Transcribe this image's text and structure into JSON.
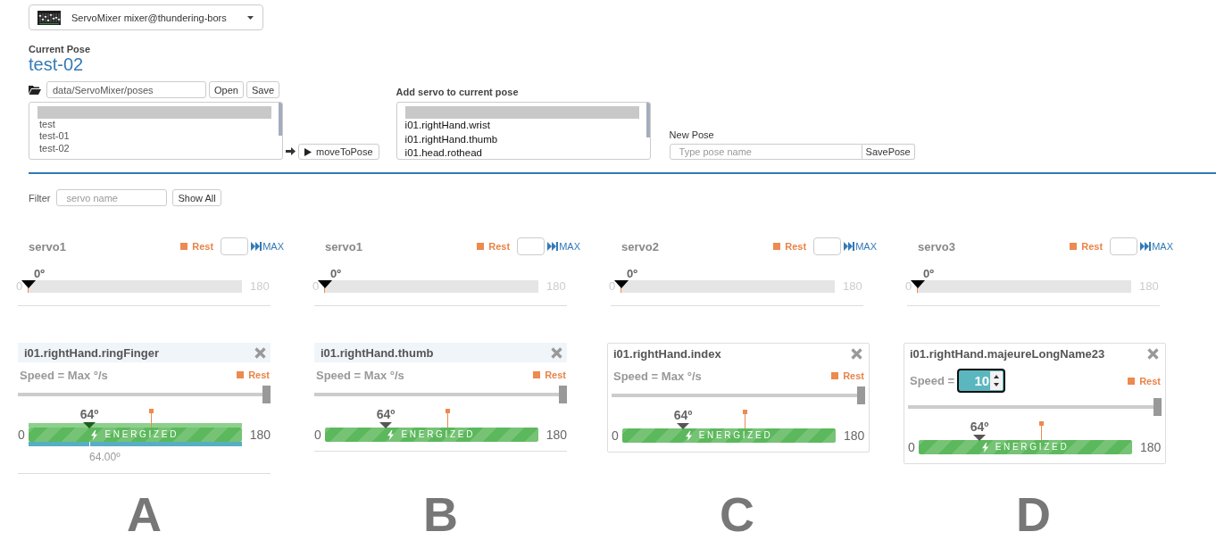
{
  "header": {
    "app": "ServoMixer",
    "service": "mixer@thundering-bors"
  },
  "current_pose": {
    "label": "Current Pose",
    "name": "test-02"
  },
  "pose_files": {
    "path": "data/ServoMixer/poses",
    "open_button": "Open",
    "save_button": "Save",
    "items": [
      {
        "selected": true
      },
      {
        "label": "test",
        "selected": false
      },
      {
        "label": "test-01",
        "selected": false
      },
      {
        "label": "test-02",
        "selected": false
      }
    ]
  },
  "move_button": "moveToPose",
  "add_servo": {
    "title": "Add servo to current pose",
    "items": [
      {
        "selected": true
      },
      {
        "label": "i01.rightHand.wrist",
        "selected": false
      },
      {
        "label": "i01.rightHand.thumb",
        "selected": false
      },
      {
        "label": "i01.head.rothead",
        "selected": false
      }
    ]
  },
  "new_pose": {
    "label": "New Pose",
    "placeholder": "Type pose name",
    "button": "SavePose"
  },
  "filter": {
    "label": "Filter",
    "placeholder": "servo name",
    "button": "Show All"
  },
  "servos": [
    {
      "name": "servo1",
      "rest": "Rest",
      "max": "MAX",
      "angle": "0º",
      "min": "0",
      "max_value": "180",
      "position": {
        "level": 0
      },
      "rest_marker": {
        "level": 0
      }
    },
    {
      "name": "servo1",
      "rest": "Rest",
      "max": "MAX",
      "angle": "0º",
      "min": "0",
      "max_value": "180",
      "position": {
        "level": 0
      },
      "rest_marker": {
        "level": 0
      }
    },
    {
      "name": "servo2",
      "rest": "Rest",
      "max": "MAX",
      "angle": "0º",
      "min": "0",
      "max_value": "180",
      "position": {
        "level": 0
      },
      "rest_marker": {
        "level": 0
      }
    },
    {
      "name": "servo3",
      "rest": "Rest",
      "max": "MAX",
      "angle": "0º",
      "min": "0",
      "max_value": "180",
      "position": {
        "level": 0
      },
      "rest_marker": {
        "level": 0
      }
    }
  ],
  "cards": [
    {
      "kind": "flat",
      "title": "i01.rightHand.ringFinger",
      "speed": {
        "kind": "text",
        "label": "Speed = Max °/s"
      },
      "rest": "Rest",
      "speed_slider": {
        "level": 1
      },
      "angle": "64º",
      "position": {
        "level": 0.285
      },
      "rest_marker": {
        "level": 0.573
      },
      "min": "0",
      "max": "180",
      "energized": true,
      "status": "ENERGIZED",
      "hover": true,
      "feedback": {
        "level": 0.285,
        "reading": "64.00º"
      },
      "caption": "A"
    },
    {
      "kind": "flat",
      "title": "i01.rightHand.thumb",
      "speed": {
        "kind": "text",
        "label": "Speed = Max °/s"
      },
      "rest": "Rest",
      "speed_slider": {
        "level": 1
      },
      "angle": "64º",
      "position": {
        "level": 0.285
      },
      "rest_marker": {
        "level": 0.573
      },
      "min": "0",
      "max": "180",
      "energized": true,
      "status": "ENERGIZED",
      "hover": false,
      "caption": "B"
    },
    {
      "kind": "boxed",
      "title": "i01.rightHand.index",
      "speed": {
        "kind": "text",
        "label": "Speed = Max °/s"
      },
      "rest": "Rest",
      "speed_slider": {
        "level": 1
      },
      "angle": "64º",
      "position": {
        "level": 0.285
      },
      "rest_marker": {
        "level": 0.573
      },
      "min": "0",
      "max": "180",
      "energized": true,
      "status": "ENERGIZED",
      "hover": false,
      "caption": "C"
    },
    {
      "kind": "boxed",
      "title": "i01.rightHand.majeureLongName23",
      "speed": {
        "kind": "spinner",
        "label": "Speed =",
        "value": "10",
        "focused": true
      },
      "rest": "Rest",
      "speed_slider": {
        "level": 1
      },
      "angle": "64º",
      "position": {
        "level": 0.285
      },
      "rest_marker": {
        "level": 0.573
      },
      "min": "0",
      "max": "180",
      "energized": true,
      "status": "ENERGIZED",
      "hover": false,
      "caption": "D"
    }
  ]
}
